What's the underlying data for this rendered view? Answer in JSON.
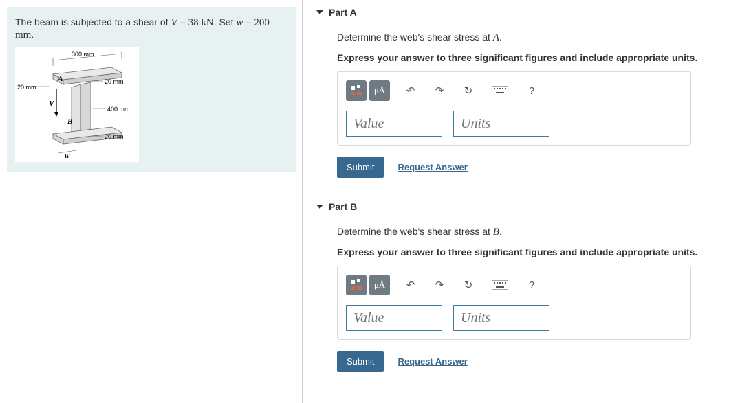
{
  "problem": {
    "prefix": "The beam is subjected to a shear of ",
    "V_var": "V",
    "V_eq": " = 38 kN",
    "mid": ". Set ",
    "w_var": "w",
    "w_eq": " = 200 mm",
    "suffix": "."
  },
  "figure": {
    "d_top": "300 mm",
    "d_left": "20 mm",
    "d_20a": "20 mm",
    "d_400": "400 mm",
    "d_20b": "20 mm",
    "pt_A": "A",
    "pt_B": "B",
    "pt_V": "V",
    "pt_w": "w"
  },
  "parts": [
    {
      "title": "Part A",
      "question_pre": "Determine the web's shear stress at ",
      "question_var": "A",
      "question_post": ".",
      "instruction": "Express your answer to three significant figures and include appropriate units.",
      "value_placeholder": "Value",
      "units_placeholder": "Units",
      "submit": "Submit",
      "request": "Request Answer"
    },
    {
      "title": "Part B",
      "question_pre": "Determine the web's shear stress at ",
      "question_var": "B",
      "question_post": ".",
      "instruction": "Express your answer to three significant figures and include appropriate units.",
      "value_placeholder": "Value",
      "units_placeholder": "Units",
      "submit": "Submit",
      "request": "Request Answer"
    }
  ],
  "tool": {
    "templates": "templates",
    "special": "μÅ",
    "undo": "↶",
    "redo": "↷",
    "reset": "↻",
    "keyboard": "⌨",
    "help": "?"
  }
}
